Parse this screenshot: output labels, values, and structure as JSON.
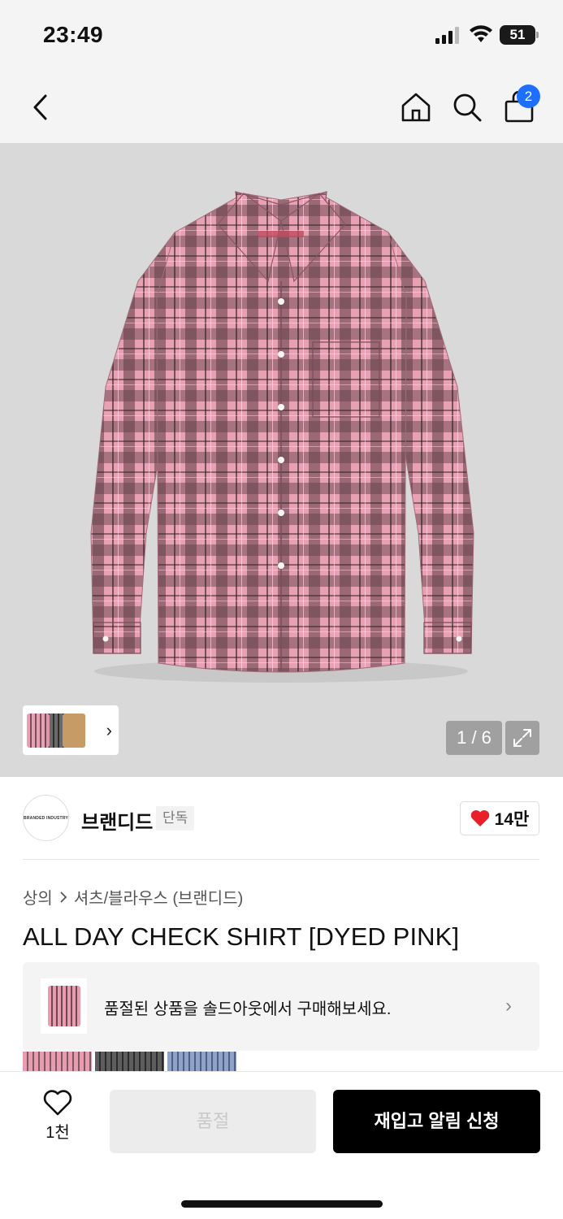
{
  "status_bar": {
    "time": "23:49",
    "battery": "51"
  },
  "nav": {
    "cart_count": "2"
  },
  "gallery": {
    "counter": "1 / 6"
  },
  "brand": {
    "logo_text": "BRANDED INDUSTRY",
    "name": "브랜디드",
    "tag": "단독",
    "likes": "14만"
  },
  "breadcrumb": {
    "category": "상의",
    "subcategory": "셔츠/블라우스 (브랜디드)"
  },
  "product": {
    "title": "ALL DAY CHECK SHIRT [DYED PINK]"
  },
  "soldout_banner": {
    "text": "품절된 상품을 솔드아웃에서 구매해보세요."
  },
  "bottom_bar": {
    "wish_count": "1천",
    "soldout_label": "품절",
    "restock_label": "재입고 알림 신청"
  },
  "colors": {
    "accent_blue": "#1f6fff",
    "heart_red": "#e8202a",
    "shirt_pink": "#e99bb0"
  }
}
